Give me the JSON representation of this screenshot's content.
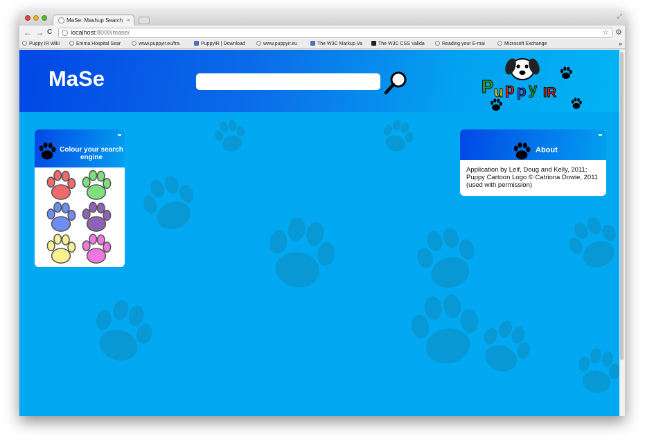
{
  "browser": {
    "tab_title": "MaSe: Mashup Search",
    "tab_close": "×",
    "url_host": "localhost",
    "url_rest": ":8000/mase/",
    "nav": {
      "back": "←",
      "forward": "→",
      "reload": "C"
    },
    "star": "☆",
    "wrench": "🔧",
    "bookmarks": [
      {
        "label": "Puppy IR Wiki",
        "icon": "globe-icon"
      },
      {
        "label": "Emma Hospital Sear",
        "icon": "globe-icon"
      },
      {
        "label": "www.puppyir.eu/fra",
        "icon": "globe-icon"
      },
      {
        "label": "PuppyIR | Download",
        "icon": "site-icon"
      },
      {
        "label": "www.puppyir.eu",
        "icon": "globe-icon"
      },
      {
        "label": "The W3C Markup Va",
        "icon": "w3c-icon"
      },
      {
        "label": "The W3C CSS Valida",
        "icon": "css-icon"
      },
      {
        "label": "Reading your E-mai",
        "icon": "globe-icon"
      },
      {
        "label": "Microsoft Exchange",
        "icon": "globe-icon"
      }
    ],
    "bookmarks_more": "»"
  },
  "header": {
    "brand": "MaSe",
    "search_value": "",
    "logo_text": "PuppyIR"
  },
  "colour_panel": {
    "title": "Colour your search engine",
    "minimize": "-",
    "paws": [
      {
        "name": "red",
        "color": "#ef6b6b"
      },
      {
        "name": "green",
        "color": "#7fdf7c"
      },
      {
        "name": "blue",
        "color": "#6f8cf4"
      },
      {
        "name": "purple",
        "color": "#8e63b5"
      },
      {
        "name": "yellow",
        "color": "#f7f190"
      },
      {
        "name": "pink",
        "color": "#ef77df"
      }
    ]
  },
  "about_panel": {
    "title": "About",
    "minimize": "-",
    "lines": [
      "Application by Leif, Doug and Kelly, 2011;",
      "Puppy Cartoon Logo © Catriona Dowie, 2011",
      "(used with permission)"
    ]
  },
  "colors": {
    "page_bg": "#02a9f2",
    "bg_paw": "#0998d6",
    "header_start": "#0147e5",
    "header_end": "#03b3f4"
  }
}
